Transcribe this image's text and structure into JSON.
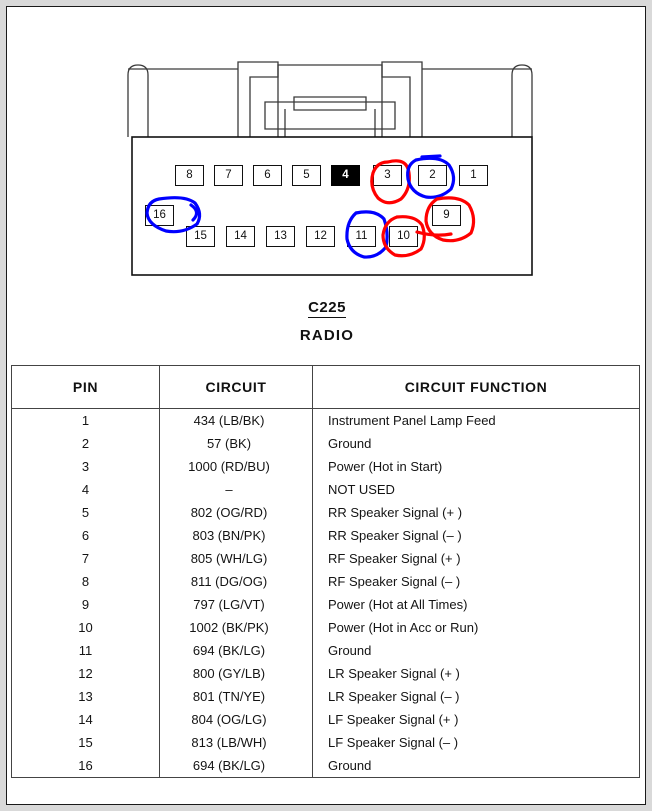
{
  "connector": {
    "id": "C225",
    "name": "RADIO",
    "pins_top_row": [
      {
        "label": "8",
        "highlighted": false,
        "filled": false
      },
      {
        "label": "7",
        "highlighted": false,
        "filled": false
      },
      {
        "label": "6",
        "highlighted": false,
        "filled": false
      },
      {
        "label": "5",
        "highlighted": false,
        "filled": false
      },
      {
        "label": "4",
        "highlighted": false,
        "filled": true
      },
      {
        "label": "3",
        "highlighted": true,
        "filled": false
      },
      {
        "label": "2",
        "highlighted": true,
        "filled": false
      },
      {
        "label": "1",
        "highlighted": false,
        "filled": false
      }
    ],
    "pins_bottom_row": [
      {
        "label": "16",
        "highlighted": true,
        "filled": false
      },
      {
        "label": "15",
        "highlighted": false,
        "filled": false
      },
      {
        "label": "14",
        "highlighted": false,
        "filled": false
      },
      {
        "label": "13",
        "highlighted": false,
        "filled": false
      },
      {
        "label": "12",
        "highlighted": false,
        "filled": false
      },
      {
        "label": "11",
        "highlighted": true,
        "filled": false
      },
      {
        "label": "10",
        "highlighted": true,
        "filled": false
      },
      {
        "label": "9",
        "highlighted": true,
        "filled": false
      }
    ],
    "annotation_colors": {
      "blue": "#0000ff",
      "red": "#ff0000"
    },
    "annotated_pins": {
      "blue": [
        "2",
        "16",
        "11"
      ],
      "red": [
        "3",
        "9",
        "10"
      ]
    }
  },
  "table": {
    "headers": {
      "pin": "PIN",
      "circuit": "CIRCUIT",
      "function": "CIRCUIT FUNCTION"
    },
    "rows": [
      {
        "pin": "1",
        "circuit": "434 (LB/BK)",
        "function": "Instrument Panel Lamp Feed"
      },
      {
        "pin": "2",
        "circuit": "57 (BK)",
        "function": "Ground"
      },
      {
        "pin": "3",
        "circuit": "1000 (RD/BU)",
        "function": "Power (Hot in Start)"
      },
      {
        "pin": "4",
        "circuit": "–",
        "function": "NOT USED"
      },
      {
        "pin": "5",
        "circuit": "802 (OG/RD)",
        "function": "RR Speaker Signal (+ )"
      },
      {
        "pin": "6",
        "circuit": "803 (BN/PK)",
        "function": "RR Speaker Signal (– )"
      },
      {
        "pin": "7",
        "circuit": "805 (WH/LG)",
        "function": "RF Speaker Signal (+ )"
      },
      {
        "pin": "8",
        "circuit": "811 (DG/OG)",
        "function": "RF Speaker Signal (– )"
      },
      {
        "pin": "9",
        "circuit": "797 (LG/VT)",
        "function": "Power (Hot at All Times)"
      },
      {
        "pin": "10",
        "circuit": "1002 (BK/PK)",
        "function": "Power (Hot in Acc or Run)"
      },
      {
        "pin": "11",
        "circuit": "694 (BK/LG)",
        "function": "Ground"
      },
      {
        "pin": "12",
        "circuit": "800 (GY/LB)",
        "function": "LR Speaker Signal (+ )"
      },
      {
        "pin": "13",
        "circuit": "801 (TN/YE)",
        "function": "LR Speaker Signal (– )"
      },
      {
        "pin": "14",
        "circuit": "804 (OG/LG)",
        "function": "LF Speaker Signal (+ )"
      },
      {
        "pin": "15",
        "circuit": "813 (LB/WH)",
        "function": "LF Speaker Signal (– )"
      },
      {
        "pin": "16",
        "circuit": "694 (BK/LG)",
        "function": "Ground"
      }
    ]
  }
}
